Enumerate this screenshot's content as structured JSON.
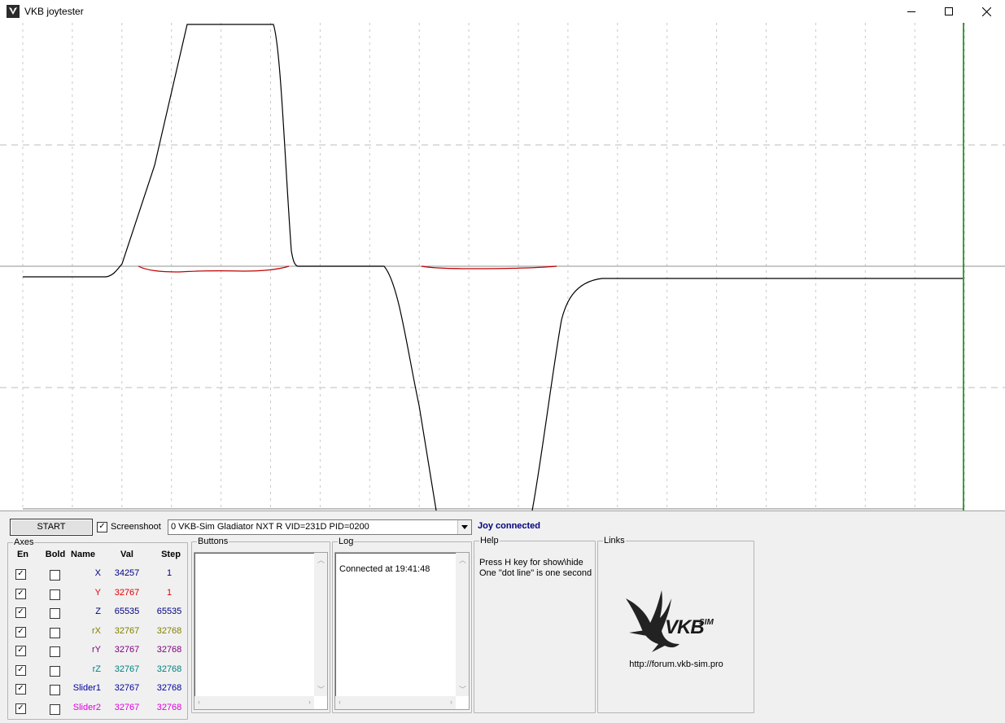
{
  "window": {
    "title": "VKB joytester",
    "icon": "vkb-bird-icon"
  },
  "controls": {
    "start_label": "START",
    "screenshot_label": "Screenshoot",
    "screenshot_checked": true,
    "device_selected": "0  VKB-Sim Gladiator NXT R   VID=231D PID=0200",
    "status": "Joy connected",
    "status_color": "#000080"
  },
  "axes": {
    "title": "Axes",
    "headers": {
      "en": "En",
      "bold": "Bold",
      "name": "Name",
      "val": "Val",
      "step": "Step"
    },
    "rows": [
      {
        "name": "X",
        "val": "34257",
        "step": "1",
        "color": "#000080",
        "en": true,
        "bold": false
      },
      {
        "name": "Y",
        "val": "32767",
        "step": "1",
        "color": "#e00000",
        "en": true,
        "bold": false
      },
      {
        "name": "Z",
        "val": "65535",
        "step": "65535",
        "color": "#000080",
        "en": true,
        "bold": false
      },
      {
        "name": "rX",
        "val": "32767",
        "step": "32768",
        "color": "#808000",
        "en": true,
        "bold": false
      },
      {
        "name": "rY",
        "val": "32767",
        "step": "32768",
        "color": "#800080",
        "en": true,
        "bold": false
      },
      {
        "name": "rZ",
        "val": "32767",
        "step": "32768",
        "color": "#008080",
        "en": true,
        "bold": false
      },
      {
        "name": "Slider1",
        "val": "32767",
        "step": "32768",
        "color": "#0000a0",
        "en": true,
        "bold": false
      },
      {
        "name": "Slider2",
        "val": "32767",
        "step": "32768",
        "color": "#e000e0",
        "en": true,
        "bold": false
      }
    ]
  },
  "buttons_panel": {
    "title": "Buttons"
  },
  "log_panel": {
    "title": "Log",
    "lines": [
      "Connected at 19:41:48"
    ]
  },
  "help_panel": {
    "title": "Help",
    "lines": [
      "Press H key for show\\hide",
      "One \"dot line\" is one second"
    ]
  },
  "links_panel": {
    "title": "Links",
    "logo_text": "VKB",
    "logo_superscript": "SIM",
    "url": "http://forum.vkb-sim.pro"
  },
  "colors": {
    "trace_x": "#000000",
    "trace_y": "#c00000",
    "cursor": "#008000",
    "grid": "#bdbdbd"
  }
}
